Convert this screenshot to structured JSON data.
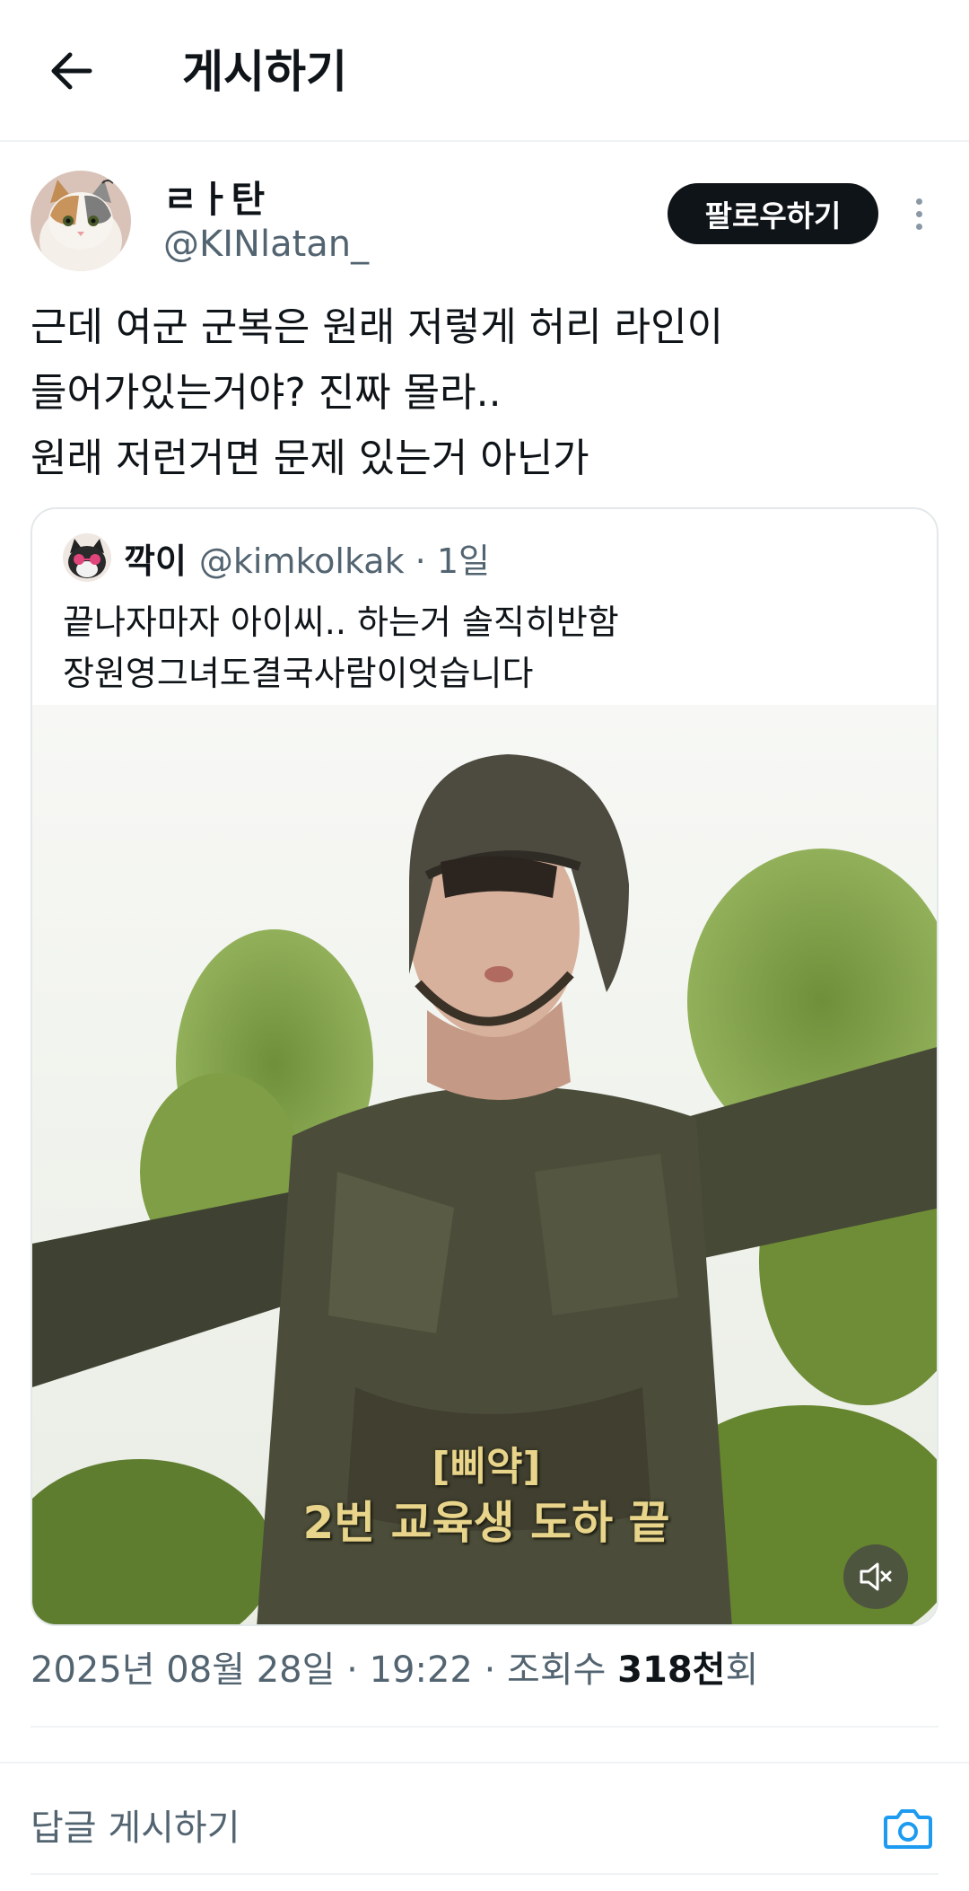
{
  "header": {
    "title": "게시하기",
    "back_icon": "arrow-left-icon"
  },
  "author": {
    "name": "ㄹㅏ탄",
    "handle": "@KINlatan_",
    "follow_label": "팔로우하기"
  },
  "post": {
    "lines": [
      "근데 여군 군복은 원래 저렇게 허리 라인이",
      "들어가있는거야? 진짜 몰라..",
      "원래 저런거면 문제 있는거 아닌가"
    ]
  },
  "quote": {
    "name": "깍이",
    "handle": "@kimkolkak · 1일",
    "lines": [
      "끝나자마자 아이씨.. 하는거 솔직히반함",
      "장원영그녀도결국사람이엇습니다"
    ],
    "subtitle_line1": "[삐약]",
    "subtitle_line2": "2번 교육생 도하 끝"
  },
  "meta": {
    "date": "2025년 08월 28일",
    "time": "19:22",
    "views_label": "조회수",
    "views_value": "318천",
    "views_suffix": "회"
  },
  "reply": {
    "placeholder": "답글 게시하기",
    "camera_icon": "camera-icon"
  },
  "colors": {
    "text": "#0f1419",
    "secondary": "#536471",
    "accent": "#1d9bf0",
    "follow_bg": "#0f1419"
  }
}
